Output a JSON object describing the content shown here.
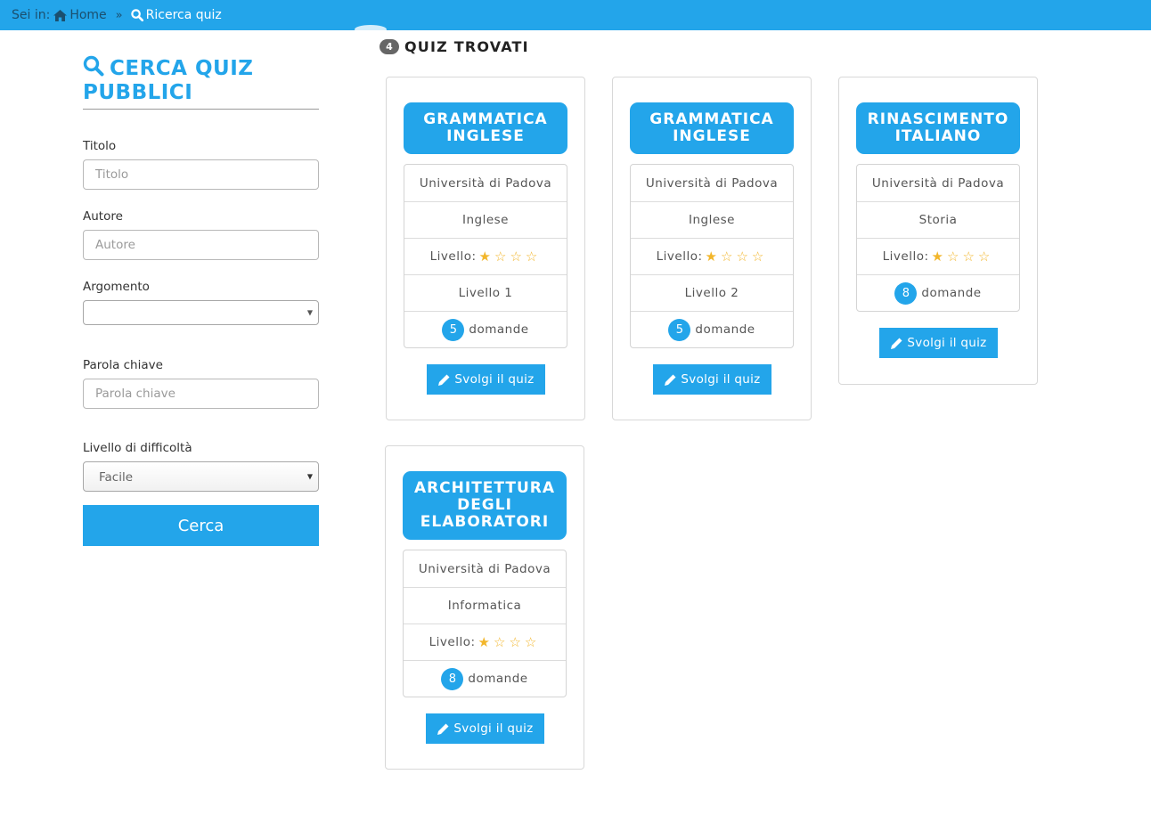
{
  "breadcrumb": {
    "prefix": "Sei in:",
    "home": "Home",
    "separator": "»",
    "current": "Ricerca quiz"
  },
  "sidebar": {
    "heading": "CERCA QUIZ PUBBLICI",
    "fields": {
      "titolo": {
        "label": "Titolo",
        "placeholder": "Titolo"
      },
      "autore": {
        "label": "Autore",
        "placeholder": "Autore"
      },
      "argomento": {
        "label": "Argomento",
        "value": ""
      },
      "parola": {
        "label": "Parola chiave",
        "placeholder": "Parola chiave"
      },
      "livello": {
        "label": "Livello di difficoltà",
        "value": "Facile"
      }
    },
    "search_button": "Cerca"
  },
  "results": {
    "count": "4",
    "title": "QUIZ TROVATI"
  },
  "cards": [
    {
      "title": "GRAMMATICA INGLESE",
      "university": "Università di Padova",
      "subject": "Inglese",
      "level_label": "Livello:",
      "stars": "★☆☆☆",
      "rating": 1,
      "level_text": "Livello 1",
      "questions": "5",
      "questions_label": "domande",
      "action": "Svolgi il quiz"
    },
    {
      "title": "GRAMMATICA INGLESE",
      "university": "Università di Padova",
      "subject": "Inglese",
      "level_label": "Livello:",
      "stars": "★☆☆☆",
      "rating": 1,
      "level_text": "Livello 2",
      "questions": "5",
      "questions_label": "domande",
      "action": "Svolgi il quiz"
    },
    {
      "title": "RINASCIMENTO ITALIANO",
      "university": "Università di Padova",
      "subject": "Storia",
      "level_label": "Livello:",
      "stars": "★☆☆☆",
      "rating": 1,
      "questions": "8",
      "questions_label": "domande",
      "action": "Svolgi il quiz"
    },
    {
      "title": "ARCHITETTURA DEGLI ELABORATORI",
      "university": "Università di Padova",
      "subject": "Informatica",
      "level_label": "Livello:",
      "stars": "★☆☆☆",
      "rating": 1,
      "questions": "8",
      "questions_label": "domande",
      "action": "Svolgi il quiz"
    }
  ],
  "colors": {
    "accent": "#23a5ea",
    "star": "#f2b62b",
    "badge_gray": "#666666"
  }
}
